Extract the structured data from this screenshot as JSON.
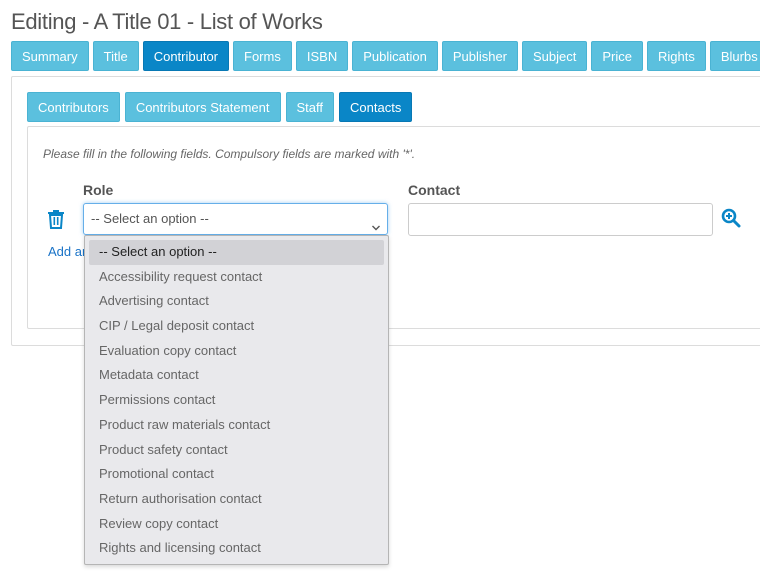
{
  "page": {
    "title": "Editing - A Title 01 - List of Works"
  },
  "main_tabs": [
    {
      "label": "Summary"
    },
    {
      "label": "Title"
    },
    {
      "label": "Contributor"
    },
    {
      "label": "Forms"
    },
    {
      "label": "ISBN"
    },
    {
      "label": "Publication"
    },
    {
      "label": "Publisher"
    },
    {
      "label": "Subject"
    },
    {
      "label": "Price"
    },
    {
      "label": "Rights"
    },
    {
      "label": "Blurbs"
    }
  ],
  "active_main_tab": "Contributor",
  "sub_tabs": [
    {
      "label": "Contributors"
    },
    {
      "label": "Contributors Statement"
    },
    {
      "label": "Staff"
    },
    {
      "label": "Contacts"
    }
  ],
  "active_sub_tab": "Contacts",
  "form": {
    "instructions": "Please fill in the following fields. Compulsory fields are marked with '*'.",
    "role_label": "Role",
    "contact_label": "Contact",
    "role_value": "-- Select an option --",
    "contact_value": "",
    "add_link": "Add an"
  },
  "dropdown_options": [
    "-- Select an option --",
    "Accessibility request contact",
    "Advertising contact",
    "CIP / Legal deposit contact",
    "Evaluation copy contact",
    "Metadata contact",
    "Permissions contact",
    "Product raw materials contact",
    "Product safety contact",
    "Promotional contact",
    "Return authorisation contact",
    "Review copy contact",
    "Rights and licensing contact"
  ],
  "icons": {
    "trash": "trash-icon",
    "search": "zoom-in-icon",
    "chevron": "chevron-down-icon"
  },
  "colors": {
    "tab": "#5bc0de",
    "tab_active": "#0a86c7",
    "link": "#1a73c7"
  }
}
